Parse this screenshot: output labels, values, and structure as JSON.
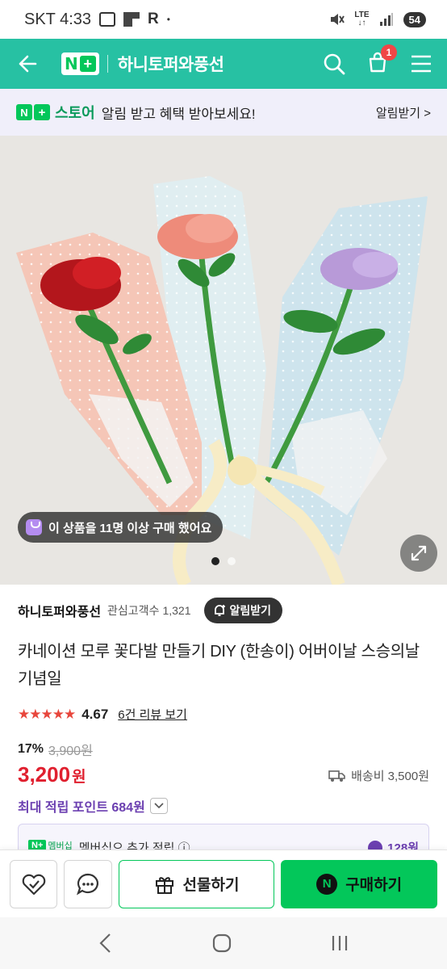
{
  "status_bar": {
    "carrier_time": "SKT 4:33",
    "r_icon": "R",
    "dot": "•",
    "network": "LTE",
    "battery": "54"
  },
  "header": {
    "logo_n": "N",
    "logo_plus": "+",
    "store_name": "하니토퍼와풍선",
    "cart_count": "1",
    "accent_color": "#27c1a3"
  },
  "notice": {
    "n": "N",
    "plus": "+",
    "brand": "스토어",
    "text": "알림 받고 혜택 받아보세요!",
    "button": "알림받기 >"
  },
  "image": {
    "purchase_notice": "이 상품을 11명 이상 구매 했어요",
    "slide_count": 2,
    "active_slide": 1
  },
  "product": {
    "seller": "하니토퍼와풍선",
    "follower_label": "관심고객수",
    "follower_count": "1,321",
    "notify_label": "알림받기",
    "title": "카네이션 모루 꽃다발 만들기 DIY (한송이) 어버이날 스승의날 기념일",
    "stars": "★★★★★",
    "rating": "4.67",
    "review_link": "6건 리뷰 보기",
    "discount": "17%",
    "original_price": "3,900원",
    "price": "3,200",
    "price_unit": "원",
    "shipping": "배송비 3,500원",
    "points": "최대 적립 포인트 684원",
    "member_badge": "N+",
    "member_badge_text": "멤버십",
    "member_text": "멤버십으 추가 적립 ⓘ",
    "member_amount": "128원"
  },
  "bottom_bar": {
    "gift_label": "선물하기",
    "buy_label": "구매하기",
    "buy_n": "N"
  }
}
